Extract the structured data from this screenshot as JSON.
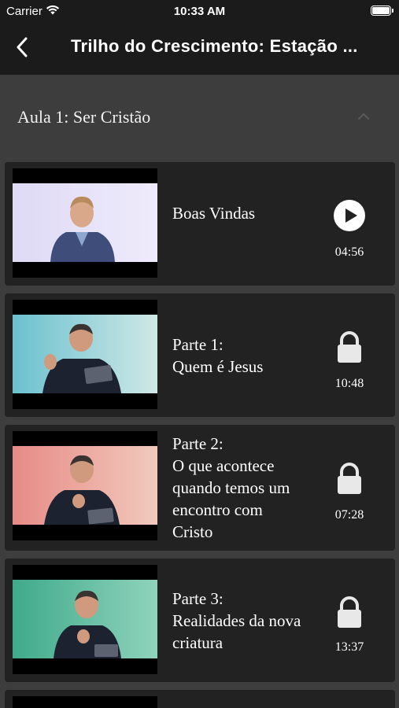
{
  "status_bar": {
    "carrier": "Carrier",
    "time": "10:33 AM"
  },
  "nav": {
    "title": "Trilho do Crescimento: Estação ..."
  },
  "section": {
    "title": "Aula 1: Ser Cristão",
    "expanded": true
  },
  "colors": {
    "nav_background": "#1b1b1b",
    "page_background": "#3d3d3d",
    "card_background": "#222222"
  },
  "lessons": [
    {
      "title": "Boas Vindas",
      "duration": "04:56",
      "status_icon": "play-icon",
      "locked": false
    },
    {
      "title": "Parte 1:\nQuem é Jesus",
      "duration": "10:48",
      "status_icon": "lock-icon",
      "locked": true
    },
    {
      "title": "Parte 2:\nO que acontece quando temos um encontro com Cristo",
      "duration": "07:28",
      "status_icon": "lock-icon",
      "locked": true
    },
    {
      "title": "Parte 3:\nRealidades da nova criatura",
      "duration": "13:37",
      "status_icon": "lock-icon",
      "locked": true
    }
  ]
}
